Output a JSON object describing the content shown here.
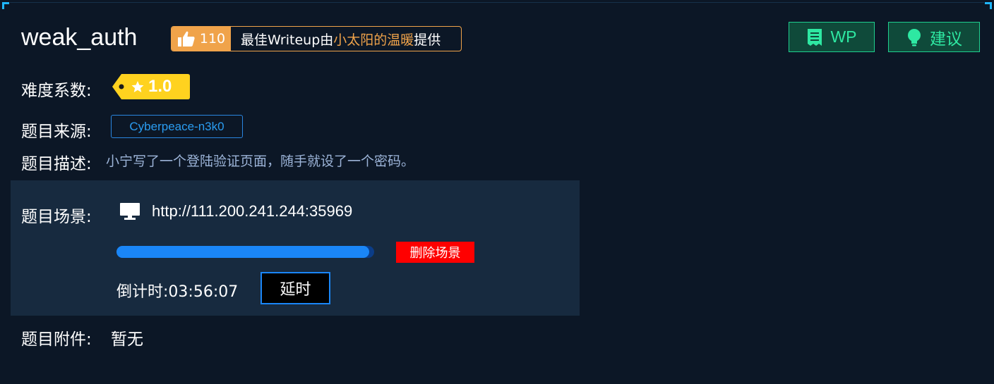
{
  "challenge": {
    "title": "weak_auth",
    "likes": "110",
    "writeup_prefix": "最佳Writeup由",
    "writeup_author": "小太阳的温暖",
    "writeup_suffix": "提供"
  },
  "buttons": {
    "wp_label": "WP",
    "suggest_label": "建议"
  },
  "fields": {
    "difficulty_label": "难度系数:",
    "difficulty_value": "1.0",
    "source_label": "题目来源:",
    "source_value": "Cyberpeace-n3k0",
    "desc_label": "题目描述:",
    "desc_value": "小宁写了一个登陆验证页面，随手就设了一个密码。",
    "attach_label": "题目附件:",
    "attach_value": "暂无"
  },
  "scene": {
    "label": "题目场景:",
    "url": "http://111.200.241.244:35969",
    "progress_percent": 98,
    "delete_label": "删除场景",
    "countdown_label": "倒计时:",
    "countdown_value": "03:56:07",
    "delay_label": "延时"
  },
  "colors": {
    "background": "#0c1726",
    "accent_orange": "#f0a34a",
    "accent_green": "#2ee8a2",
    "star_yellow": "#ffd21f",
    "progress_blue": "#1a86f7",
    "danger_red": "#ff0000"
  },
  "icons": {
    "like": "thumbs-up-icon",
    "wp": "document-icon",
    "suggest": "lightbulb-icon",
    "difficulty": "star-tag-icon",
    "scene": "monitor-icon"
  }
}
